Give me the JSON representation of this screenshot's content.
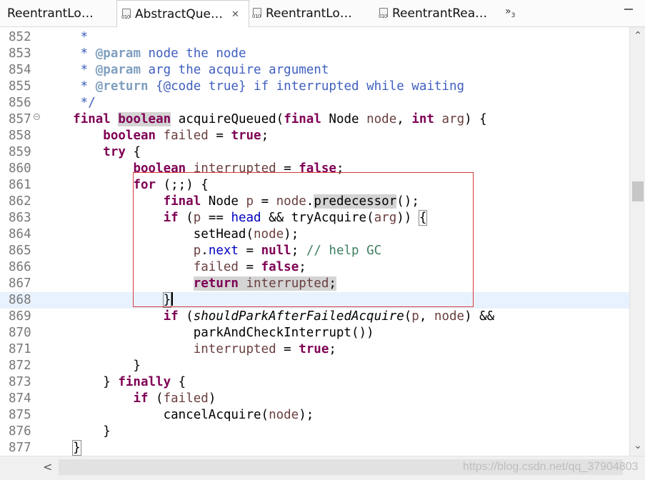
{
  "tabs": [
    {
      "label": "ReentrantLo…"
    },
    {
      "label": "AbstractQue…",
      "close": "✕"
    },
    {
      "label": "ReentrantLo…"
    },
    {
      "label": "ReentrantRea…"
    }
  ],
  "tab_icon_badge": "010",
  "overflow": {
    "chevron": "»",
    "count": "3"
  },
  "editor": {
    "lines": [
      {
        "n": "852",
        "t": [
          [
            "     *",
            "jd"
          ]
        ]
      },
      {
        "n": "853",
        "t": [
          [
            "     * ",
            "jd"
          ],
          [
            "@param",
            "jdt"
          ],
          [
            " node the node",
            "jd"
          ]
        ]
      },
      {
        "n": "854",
        "t": [
          [
            "     * ",
            "jd"
          ],
          [
            "@param",
            "jdt"
          ],
          [
            " arg the acquire argument",
            "jd"
          ]
        ]
      },
      {
        "n": "855",
        "t": [
          [
            "     * ",
            "jd"
          ],
          [
            "@return",
            "jdt"
          ],
          [
            " {@code true} if interrupted while waiting",
            "jd"
          ]
        ]
      },
      {
        "n": "856",
        "t": [
          [
            "     */",
            "jd"
          ]
        ]
      },
      {
        "n": "857",
        "fold": "⊖",
        "t": [
          [
            "    ",
            ""
          ],
          [
            "final",
            "kw"
          ],
          [
            " ",
            ""
          ],
          [
            "boolean",
            "kw occ"
          ],
          [
            " acquireQueued(",
            ""
          ],
          [
            "final",
            "kw"
          ],
          [
            " Node ",
            ""
          ],
          [
            "node",
            "lv"
          ],
          [
            ", ",
            ""
          ],
          [
            "int",
            "kw"
          ],
          [
            " ",
            ""
          ],
          [
            "arg",
            "lv"
          ],
          [
            ") {",
            ""
          ]
        ]
      },
      {
        "n": "858",
        "t": [
          [
            "        ",
            ""
          ],
          [
            "boolean",
            "kw"
          ],
          [
            " ",
            ""
          ],
          [
            "failed",
            "lv"
          ],
          [
            " = ",
            ""
          ],
          [
            "true",
            "kw"
          ],
          [
            ";",
            ""
          ]
        ]
      },
      {
        "n": "859",
        "t": [
          [
            "        ",
            ""
          ],
          [
            "try",
            "kw"
          ],
          [
            " {",
            ""
          ]
        ]
      },
      {
        "n": "860",
        "t": [
          [
            "            ",
            ""
          ],
          [
            "boolean",
            "kw"
          ],
          [
            " ",
            ""
          ],
          [
            "interrupted",
            "lv"
          ],
          [
            " = ",
            ""
          ],
          [
            "false",
            "kw"
          ],
          [
            ";",
            ""
          ]
        ]
      },
      {
        "n": "861",
        "t": [
          [
            "            ",
            ""
          ],
          [
            "for",
            "kw"
          ],
          [
            " (;;) {",
            ""
          ]
        ]
      },
      {
        "n": "862",
        "t": [
          [
            "                ",
            ""
          ],
          [
            "final",
            "kw"
          ],
          [
            " Node ",
            ""
          ],
          [
            "p",
            "lv"
          ],
          [
            " = ",
            ""
          ],
          [
            "node",
            "lv"
          ],
          [
            ".",
            ""
          ],
          [
            "predecessor",
            "occ"
          ],
          [
            "();",
            ""
          ]
        ]
      },
      {
        "n": "863",
        "t": [
          [
            "                ",
            ""
          ],
          [
            "if",
            "kw"
          ],
          [
            " (",
            ""
          ],
          [
            "p",
            "lv"
          ],
          [
            " == ",
            ""
          ],
          [
            "head",
            "fld"
          ],
          [
            " && tryAcquire(",
            ""
          ],
          [
            "arg",
            "lv"
          ],
          [
            ")) ",
            ""
          ],
          [
            "{",
            "brk"
          ]
        ]
      },
      {
        "n": "864",
        "t": [
          [
            "                    setHead(",
            ""
          ],
          [
            "node",
            "lv"
          ],
          [
            ");",
            ""
          ]
        ]
      },
      {
        "n": "865",
        "t": [
          [
            "                    ",
            ""
          ],
          [
            "p",
            "lv"
          ],
          [
            ".",
            ""
          ],
          [
            "next",
            "fld"
          ],
          [
            " = ",
            ""
          ],
          [
            "null",
            "kw"
          ],
          [
            "; ",
            ""
          ],
          [
            "// help GC",
            "cm"
          ]
        ]
      },
      {
        "n": "866",
        "t": [
          [
            "                    ",
            ""
          ],
          [
            "failed",
            "lv"
          ],
          [
            " = ",
            ""
          ],
          [
            "false",
            "kw"
          ],
          [
            ";",
            ""
          ]
        ]
      },
      {
        "n": "867",
        "t": [
          [
            "                    ",
            ""
          ],
          [
            "return",
            "kw occ"
          ],
          [
            " ",
            "occ"
          ],
          [
            "interrupted",
            "lv occ"
          ],
          [
            ";",
            "occ"
          ]
        ]
      },
      {
        "n": "868",
        "current": true,
        "caret": true,
        "t": [
          [
            "                ",
            ""
          ],
          [
            "}",
            "brk"
          ]
        ]
      },
      {
        "n": "869",
        "t": [
          [
            "                ",
            ""
          ],
          [
            "if",
            "kw"
          ],
          [
            " (",
            ""
          ],
          [
            "shouldParkAfterFailedAcquire",
            "it"
          ],
          [
            "(",
            ""
          ],
          [
            "p",
            "lv"
          ],
          [
            ", ",
            ""
          ],
          [
            "node",
            "lv"
          ],
          [
            ") &&",
            ""
          ]
        ]
      },
      {
        "n": "870",
        "t": [
          [
            "                    parkAndCheckInterrupt())",
            ""
          ]
        ]
      },
      {
        "n": "871",
        "t": [
          [
            "                    ",
            ""
          ],
          [
            "interrupted",
            "lv"
          ],
          [
            " = ",
            ""
          ],
          [
            "true",
            "kw"
          ],
          [
            ";",
            ""
          ]
        ]
      },
      {
        "n": "872",
        "t": [
          [
            "            }",
            ""
          ]
        ]
      },
      {
        "n": "873",
        "t": [
          [
            "        } ",
            ""
          ],
          [
            "finally",
            "kw"
          ],
          [
            " {",
            ""
          ]
        ]
      },
      {
        "n": "874",
        "t": [
          [
            "            ",
            ""
          ],
          [
            "if",
            "kw"
          ],
          [
            " (",
            ""
          ],
          [
            "failed",
            "lv"
          ],
          [
            ")",
            ""
          ]
        ]
      },
      {
        "n": "875",
        "t": [
          [
            "                cancelAcquire(",
            ""
          ],
          [
            "node",
            "lv"
          ],
          [
            ");",
            ""
          ]
        ]
      },
      {
        "n": "876",
        "t": [
          [
            "        }",
            ""
          ]
        ]
      },
      {
        "n": "877",
        "t": [
          [
            "    ",
            ""
          ],
          [
            "}",
            "brk"
          ]
        ]
      }
    ]
  },
  "scroll": {
    "up": "⌃",
    "down": "⌄",
    "left": "<"
  },
  "watermark": "https://blog.csdn.net/qq_37904803",
  "colors": {
    "keyword": "#7f0055",
    "javadoc": "#3f5fbf",
    "javadoc_tag": "#7f9fbf",
    "comment": "#3f7f5f",
    "field": "#0000c0",
    "local_var": "#6a3e3e",
    "current_line": "#e8f2fe",
    "annotation_box": "#d83a3a"
  }
}
